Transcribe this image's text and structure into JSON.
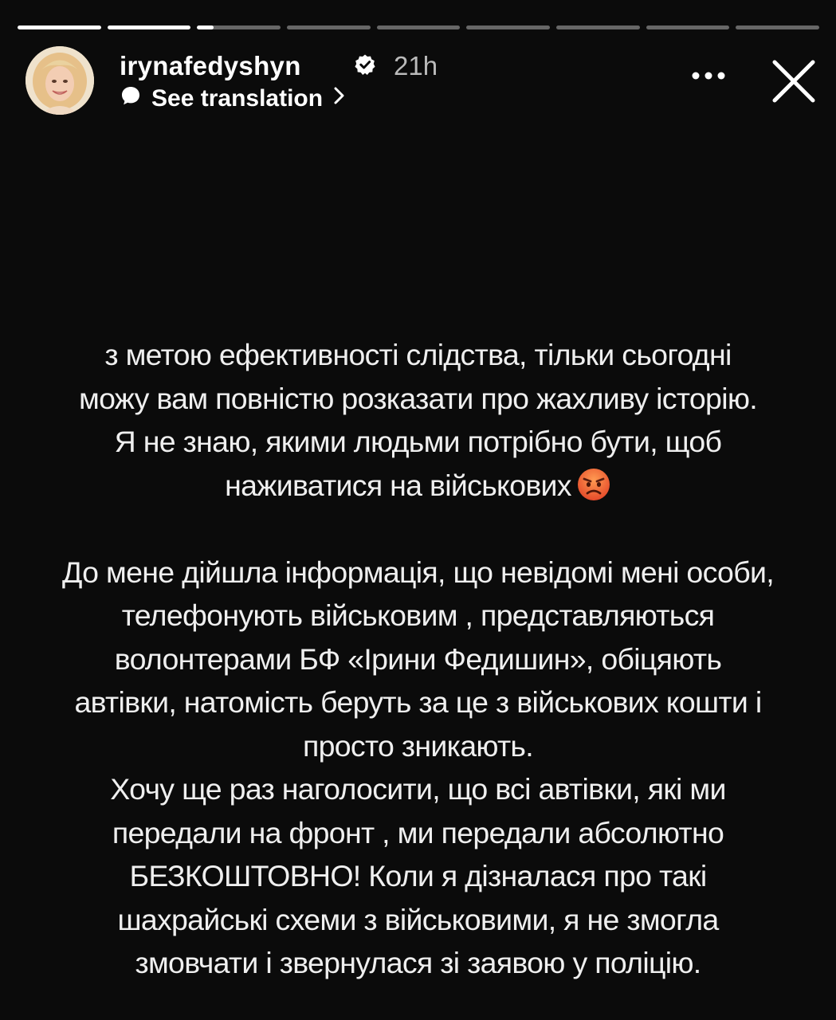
{
  "story": {
    "progress": {
      "segment_count": 9,
      "fills": [
        1,
        1,
        0.2,
        0,
        0,
        0,
        0,
        0,
        0
      ]
    },
    "header": {
      "username": "irynafedyshyn",
      "time_ago": "21h",
      "translate_label": "See translation",
      "icons": {
        "avatar": "profile-photo",
        "verified": "verified-badge-icon",
        "translate": "speech-bubble-icon",
        "chevron": "chevron-right-icon",
        "more": "more-options-icon",
        "close": "close-icon"
      }
    },
    "text": {
      "lines": [
        "з метою ефективності слідства, тільки сьогодні",
        "можу вам повністю розказати про жахливу історію.",
        "Я не знаю, якими людьми потрібно бути, щоб",
        "наживатися на військових",
        "",
        "До мене дійшла інформація, що невідомі мені особи,",
        "телефонують військовим , представляються",
        "волонтерами БФ «Ірини Федишин», обіцяють",
        "автівки, натомість беруть за це з військових кошти і",
        "просто зникають.",
        "Хочу ще раз наголосити, що всі автівки, які ми",
        "передали на фронт , ми передали абсолютно",
        "БЕЗКОШТОВНО! Коли  я дізналася про такі",
        "шахрайські схеми з військовими, я не змогла",
        "змовчати і звернулася зі заявою у поліцію."
      ],
      "emoji_after_line_4": "angry-face-emoji"
    },
    "colors": {
      "background": "#0b0b0b",
      "text": "#efefef",
      "progress_track": "rgba(255,255,255,0.38)",
      "progress_fill": "#ffffff",
      "verified_badge": "#ffffff",
      "emoji_face": "#f26a3b"
    }
  }
}
